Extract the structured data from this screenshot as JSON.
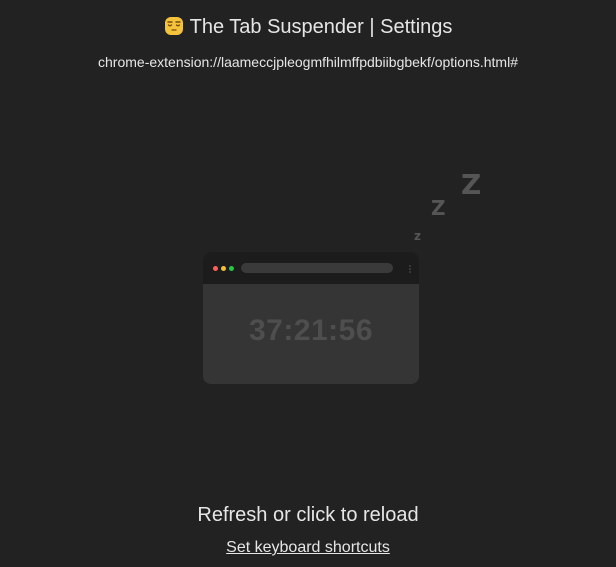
{
  "header": {
    "title": "The Tab Suspender | Settings",
    "icon": "sleeping-face-icon"
  },
  "url": {
    "text": "chrome-extension://laameccjpleogmfhilmffpdbiibgbekf/options.html#"
  },
  "illustration": {
    "zzz_letters": [
      "z",
      "Z",
      "Z"
    ],
    "timer_text": "37:21:56",
    "window_dot_colors": [
      "#ff5f57",
      "#febc2e",
      "#28c840"
    ],
    "icons": [
      "sleeping-window-illustration",
      "zzz-icon",
      "kebab-menu-icon"
    ]
  },
  "actions": {
    "reload_text": "Refresh or click to reload",
    "shortcuts_link": "Set keyboard shortcuts"
  },
  "colors": {
    "background": "#222222",
    "text": "#e6e6e6",
    "window_body": "#353535",
    "window_bar": "#1c1c1c",
    "zzz": "#555555",
    "timer": "#4e4e4e"
  }
}
